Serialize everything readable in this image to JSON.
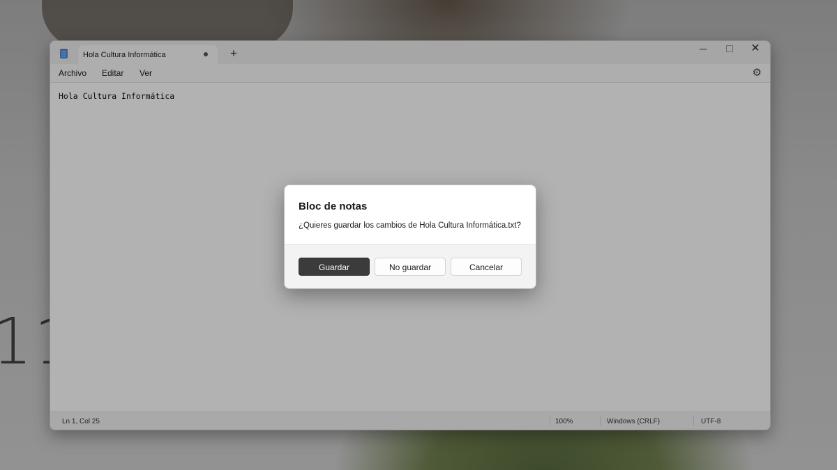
{
  "desktop": {
    "clock_fragment": "11:"
  },
  "window": {
    "tab_title": "Hola Cultura Informática",
    "new_tab_symbol": "+",
    "close_symbol": "✕",
    "icon": "notepad-icon"
  },
  "menu": {
    "items": [
      "Archivo",
      "Editar",
      "Ver"
    ],
    "settings_icon": "gear-icon"
  },
  "editor": {
    "content": "Hola Cultura Informática"
  },
  "status": {
    "position": "Ln 1, Col 25",
    "zoom": "100%",
    "line_ending": "Windows (CRLF)",
    "encoding": "UTF-8"
  },
  "dialog": {
    "title": "Bloc de notas",
    "message": "¿Quieres guardar los cambios de Hola Cultura Informática.txt?",
    "buttons": {
      "save": "Guardar",
      "dont_save": "No guardar",
      "cancel": "Cancelar"
    }
  }
}
